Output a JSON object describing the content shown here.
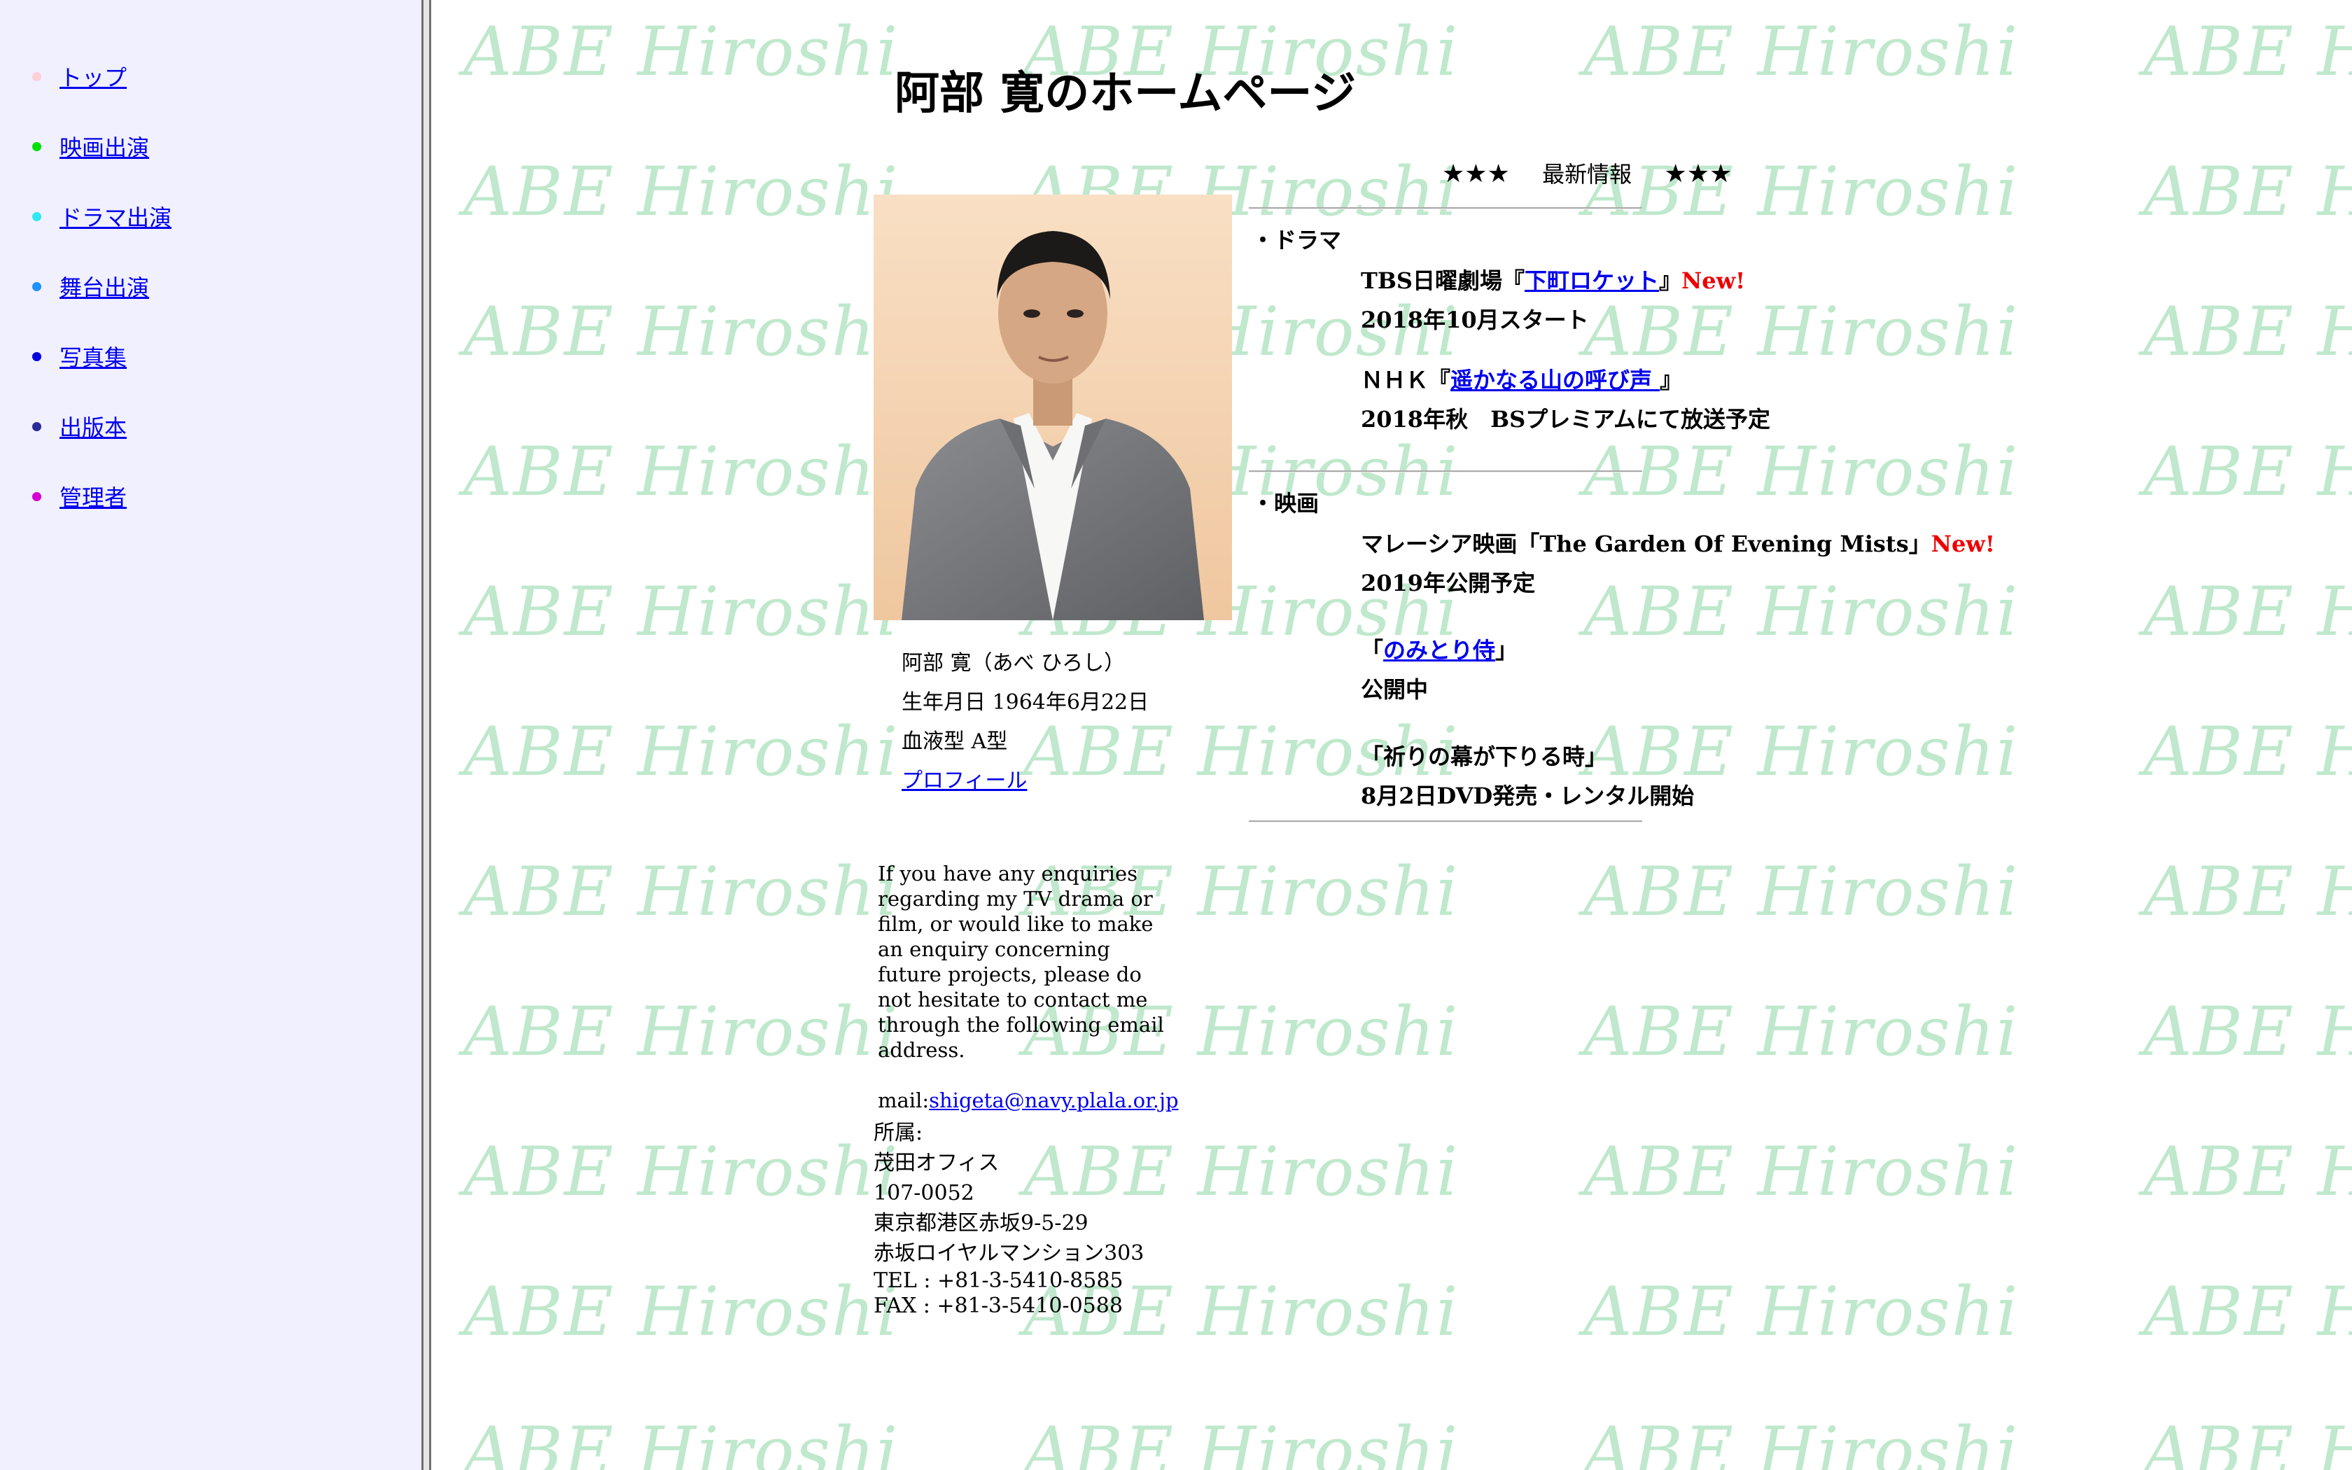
{
  "sidebar": {
    "items": [
      {
        "label": "トップ",
        "dot_color": "#ffd0d8"
      },
      {
        "label": "映画出演",
        "dot_color": "#00e000"
      },
      {
        "label": "ドラマ出演",
        "dot_color": "#30e8f0"
      },
      {
        "label": "舞台出演",
        "dot_color": "#1e90ff"
      },
      {
        "label": "写真集",
        "dot_color": "#0000e0"
      },
      {
        "label": "出版本",
        "dot_color": "#2a2a9a"
      },
      {
        "label": "管理者",
        "dot_color": "#d400d4"
      }
    ]
  },
  "watermark_text": "ABE Hiroshi",
  "page_title": "阿部 寛のホームページ",
  "news": {
    "stars": "★★★",
    "heading": "最新情報"
  },
  "profile": {
    "name": "阿部 寛（あべ ひろし）",
    "birth": "生年月日 1964年6月22日",
    "blood": "血液型 A型",
    "profile_link": "プロフィール"
  },
  "contact": {
    "text": "If you have any enquiries regarding my TV drama or film, or would like to make an enquiry concerning future projects, please do not hesitate to contact me through the following email address.",
    "mail_label": "mail:",
    "mail_address": "shigeta@navy.plala.or.jp"
  },
  "address": {
    "label": "所属:",
    "office": "茂田オフィス",
    "postal": "107-0052",
    "street": "東京都港区赤坂9-5-29",
    "building": "赤坂ロイヤルマンション303",
    "tel": "TEL : +81-3-5410-8585",
    "fax": "FAX : +81-3-5410-0588"
  },
  "drama": {
    "category": "・ドラマ",
    "item1": {
      "prefix": "TBS日曜劇場『",
      "link": "下町ロケット",
      "suffix": "』",
      "new": "New!",
      "line2": "2018年10月スタート"
    },
    "item2": {
      "prefix": "ＮＨＫ『",
      "link": "遥かなる山の呼び声 ",
      "suffix": "』",
      "line2": "2018年秋　BSプレミアムにて放送予定"
    }
  },
  "movie": {
    "category": "・映画",
    "item1": {
      "text": "マレーシア映画「The Garden Of Evening Mists」",
      "new": "New!",
      "line2": "2019年公開予定"
    },
    "item2": {
      "prefix": "「",
      "link": "のみとり侍",
      "suffix": "」",
      "line2": "公開中"
    },
    "item3": {
      "text": "「祈りの幕が下りる時」",
      "line2": "8月2日DVD発売・レンタル開始"
    }
  }
}
